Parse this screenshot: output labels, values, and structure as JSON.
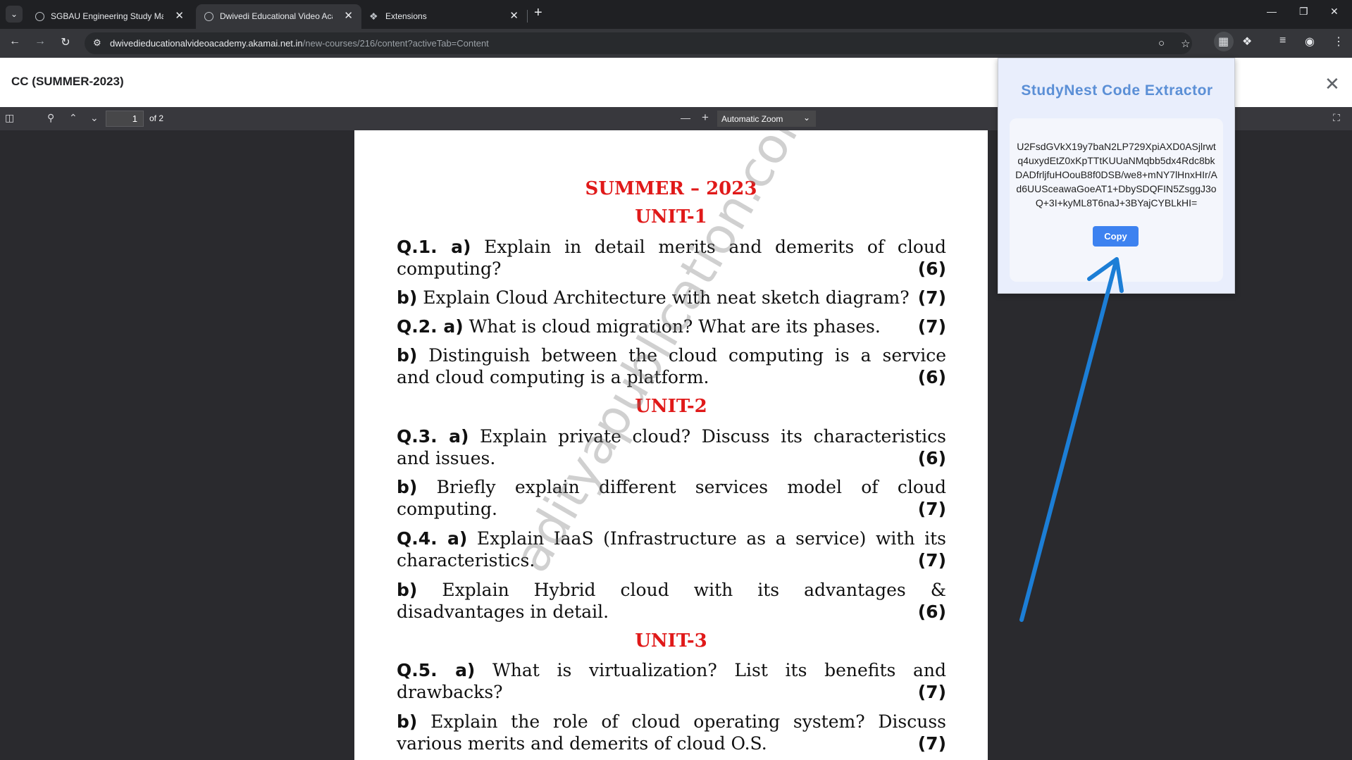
{
  "browser": {
    "tabs": [
      {
        "title": "SGBAU Engineering Study Materi",
        "active": false
      },
      {
        "title": "Dwivedi Educational Video Acad",
        "active": true
      },
      {
        "title": "Extensions",
        "active": false
      }
    ],
    "url_host": "dwivedieducationalvideoacademy.akamai.net.in",
    "url_path": "/new-courses/216/content?activeTab=Content"
  },
  "dialog": {
    "title": "CC (SUMMER-2023)"
  },
  "pdf_toolbar": {
    "page_number": "1",
    "page_of": "of 2",
    "zoom": "Automatic Zoom"
  },
  "document": {
    "title": "SUMMER – 2023",
    "unit1": "UNIT-1",
    "unit2": "UNIT-2",
    "unit3": "UNIT-3",
    "q1a_label": "Q.1.  a)",
    "q1a_text1": "Explain in detail merits and demerits of cloud",
    "q1a_text2": "computing?",
    "q1a_marks": "(6)",
    "q1b_label": "b)",
    "q1b_text": "Explain Cloud Architecture with neat sketch diagram?",
    "q1b_marks": "(7)",
    "q2a_label": "Q.2.  a)",
    "q2a_text": "What is cloud migration? What are its phases.",
    "q2a_marks": "(7)",
    "q2b_label": "b)",
    "q2b_text1": "Distinguish between the cloud computing is a service",
    "q2b_text2": "and cloud computing is a platform.",
    "q2b_marks": "(6)",
    "q3a_label": "Q.3.  a)",
    "q3a_text1": "Explain private cloud? Discuss its characteristics",
    "q3a_text2": "and issues.",
    "q3a_marks": "(6)",
    "q3b_label": "b)",
    "q3b_text1": "Briefly explain different services model of cloud",
    "q3b_text2": "computing.",
    "q3b_marks": "(7)",
    "q4a_label": "Q.4.  a)",
    "q4a_text1": "Explain IaaS (Infrastructure as a service) with its",
    "q4a_text2": "characteristics.",
    "q4a_marks": "(7)",
    "q4b_label": "b)",
    "q4b_text1": "Explain Hybrid cloud with its advantages &",
    "q4b_text2": "disadvantages in detail.",
    "q4b_marks": "(6)",
    "q5a_label": "Q.5.  a)",
    "q5a_text1": "What is virtualization? List its benefits and",
    "q5a_text2": "drawbacks?",
    "q5a_marks": "(7)",
    "q5b_label": "b)",
    "q5b_text1": "Explain the role of cloud operating system? Discuss",
    "q5b_text2": "various merits and demerits of cloud O.S.",
    "q5b_marks": "(7)",
    "watermark": "adityapublication.com"
  },
  "extension_popup": {
    "title": "StudyNest Code Extractor",
    "code": "U2FsdGVkX19y7baN2LP729XpiAXD0ASjlrwtq4uxydEtZ0xKpTTtKUUaNMqbb5dx4Rdc8bkDADfrljfuHOouB8f0DSB/we8+mNY7lHnxHIr/Ad6UUSceawaGoeAT1+DbySDQFIN5ZsggJ3oQ+3I+kyML8T6naJ+3BYajCYBLkHI=",
    "copy_label": "Copy"
  },
  "colors": {
    "accent": "#3d82f0",
    "heading_red": "#e01919",
    "annotation_arrow": "#1c7ed6"
  }
}
